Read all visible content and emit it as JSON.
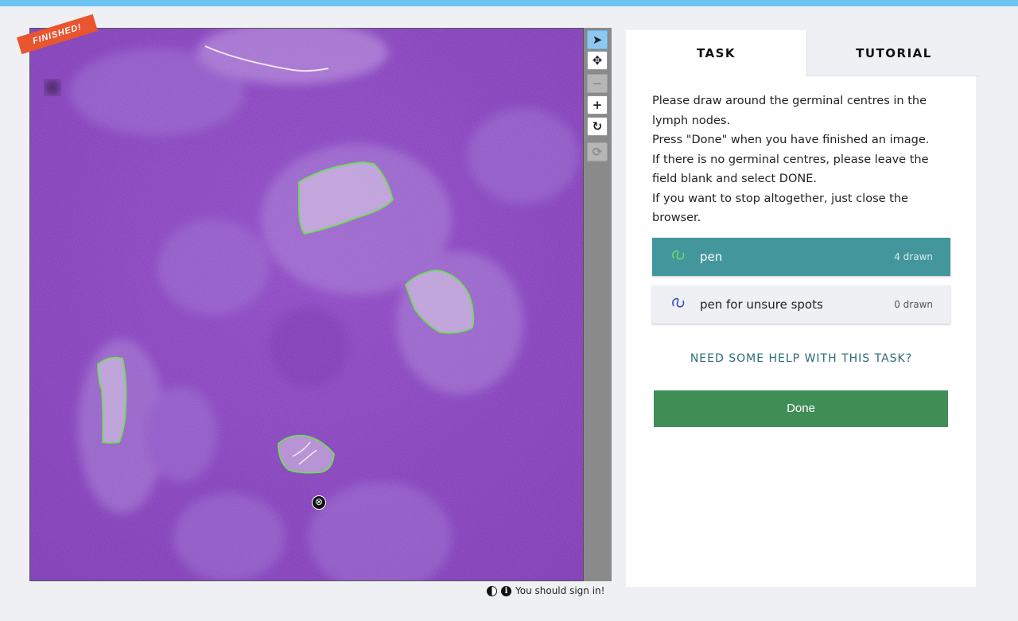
{
  "viewer": {
    "ribbon": "FINISHED!",
    "delete_glyph": "⊗",
    "annotation_color": "#6bdf52",
    "annotation_count": 4
  },
  "tools": [
    {
      "name": "pointer-tool",
      "glyph": "➤"
    },
    {
      "name": "pan-tool",
      "glyph": "✥"
    },
    {
      "name": "zoom-out-tool",
      "glyph": "−"
    },
    {
      "name": "zoom-in-tool",
      "glyph": "+"
    },
    {
      "name": "rotate-tool",
      "glyph": "↻"
    },
    {
      "name": "reset-tool",
      "glyph": "⟳"
    }
  ],
  "footer": {
    "icons": [
      "contrast-icon",
      "info-icon"
    ],
    "text": "You should sign in!"
  },
  "panel": {
    "tabs": {
      "task": "TASK",
      "tutorial": "TUTORIAL"
    },
    "instructions": [
      "Please draw around the germinal centres in the",
      "lymph nodes.",
      "Press \"Done\" when you have finished an image.",
      "If there is no germinal centres, please leave the",
      "field blank and select DONE.",
      "If you want to stop altogether, just close the",
      "browser."
    ],
    "drawing_tools": [
      {
        "label": "pen",
        "count": "4 drawn",
        "color": "#6be06b",
        "icon": "freehand-pen-icon"
      },
      {
        "label": "pen for unsure spots",
        "count": "0 drawn",
        "color": "#3344cc",
        "icon": "freehand-pen-icon"
      }
    ],
    "help_link": "NEED SOME HELP WITH THIS TASK?",
    "done_label": "Done"
  }
}
